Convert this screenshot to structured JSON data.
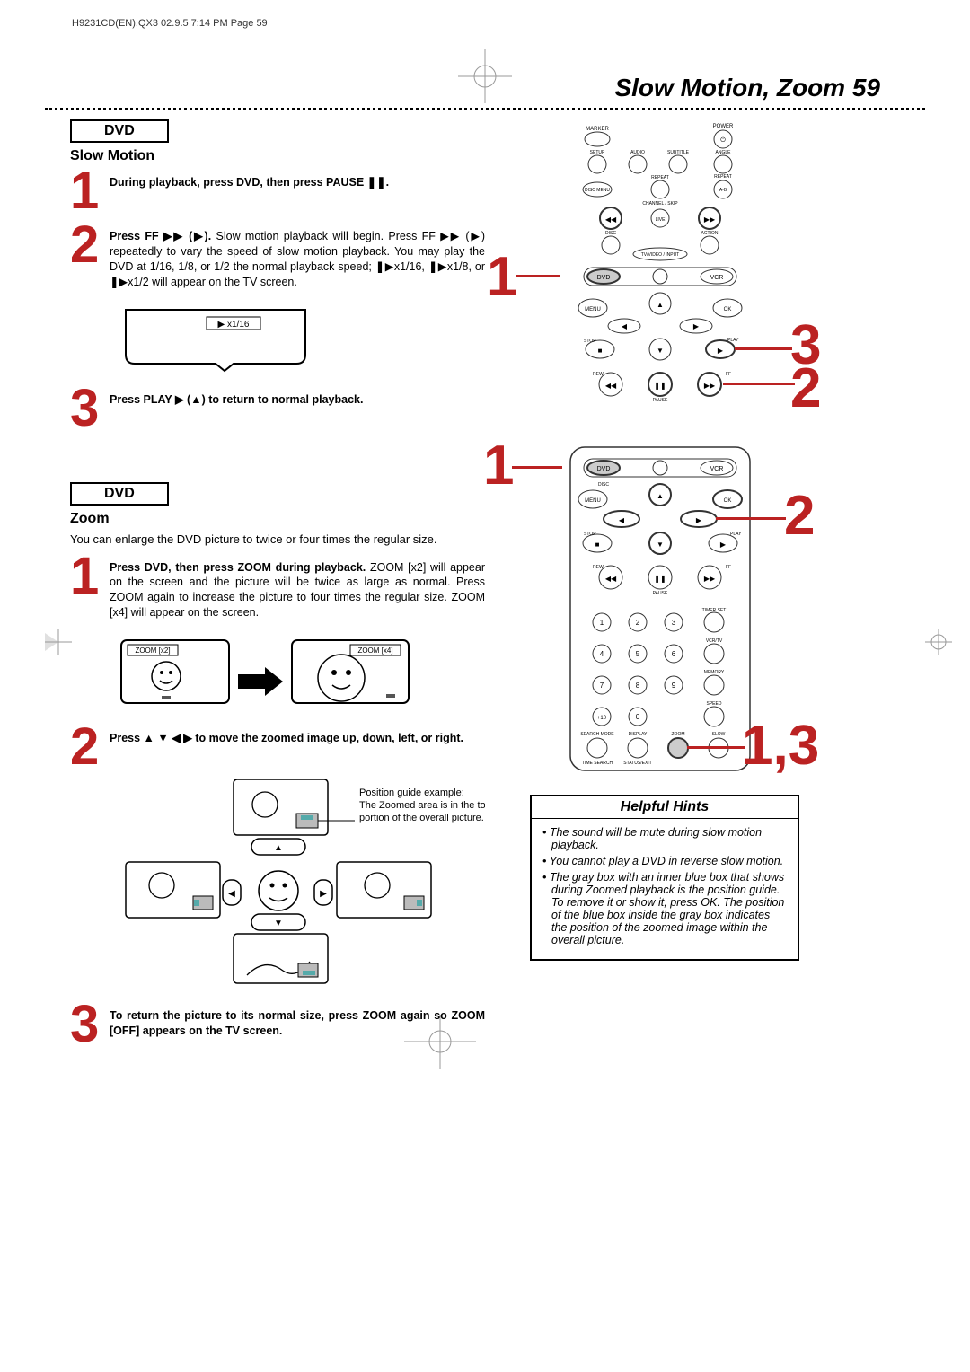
{
  "header_stamp": "H9231CD(EN).QX3   02.9.5  7:14 PM   Page 59",
  "page_title": "Slow Motion, Zoom   59",
  "slow": {
    "badge": "DVD",
    "title": "Slow Motion",
    "step1": {
      "num": "1",
      "bold": "During playback, press DVD, then press PAUSE ❚❚."
    },
    "step2": {
      "num": "2",
      "lead_bold": "Press FF ▶▶ (▶).",
      "body": " Slow motion playback will begin. Press FF ▶▶ (▶) repeatedly to vary the speed of slow motion playback. You may play the DVD at 1/16, 1/8, or 1/2 the normal playback speed; ❚▶x1/16, ❚▶x1/8, or ❚▶x1/2 will appear on the TV screen."
    },
    "tv_caption": "▶ x1/16",
    "step3": {
      "num": "3",
      "bold": "Press PLAY ▶ (▲) to return to normal playback."
    },
    "callouts": {
      "c1": "1",
      "c2": "2",
      "c3": "3"
    }
  },
  "zoom": {
    "badge": "DVD",
    "title": "Zoom",
    "intro": "You can enlarge the DVD picture to twice or four times the regular size.",
    "step1": {
      "num": "1",
      "bold": "Press DVD, then press ZOOM during playback.",
      "body": " ZOOM [x2] will appear on the screen and the picture will be twice as large as normal. Press ZOOM again to increase the picture to four times the regular size. ZOOM [x4] will appear on the screen."
    },
    "x2_label": "ZOOM [x2]",
    "x4_label": "ZOOM [x4]",
    "step2": {
      "num": "2",
      "bold": "Press ▲ ▼ ◀ ▶ to move the zoomed image up, down, left, or right."
    },
    "pos_guide": {
      "l1": "Position guide example:",
      "l2": "The Zoomed area is in the top",
      "l3": "portion of the overall picture."
    },
    "step3": {
      "num": "3",
      "bold": "To return the picture to its normal size, press ZOOM again so ZOOM [OFF] appears on the TV screen."
    },
    "callouts": {
      "c1": "1",
      "c2": "2",
      "c13": "1,3"
    }
  },
  "hints": {
    "title": "Helpful Hints",
    "items": [
      "The sound will be mute during slow motion playback.",
      "You cannot play a DVD in reverse slow motion.",
      "The gray box with an inner blue box that shows during Zoomed playback is the position guide. To remove it or show it, press OK. The position of the blue box inside the gray box indicates the position of the zoomed image within the overall picture."
    ]
  },
  "remote_labels": {
    "top": [
      "MARKER",
      "POWER",
      "SETUP",
      "AUDIO",
      "SUBTITLE",
      "ANGLE",
      "DISC MENU",
      "REPEAT",
      "REPEAT A-B",
      "CHANNEL/SKIP",
      "DISC",
      "ACTION",
      "TV/VIDEO/INPUT",
      "DVD",
      "VCR",
      "MENU",
      "OK",
      "STOP",
      "PLAY",
      "REW",
      "PAUSE",
      "FF"
    ],
    "bottom": [
      "DVD",
      "VCR",
      "DISC",
      "MENU",
      "OK",
      "STOP",
      "PLAY",
      "REW",
      "PAUSE",
      "FF",
      "TIMER SET",
      "VCR/TV",
      "MEMORY",
      "SPEED",
      "SEARCH MODE",
      "DISPLAY",
      "ZOOM",
      "SLOW",
      "TIME SEARCH",
      "STATUS/EXIT"
    ]
  }
}
